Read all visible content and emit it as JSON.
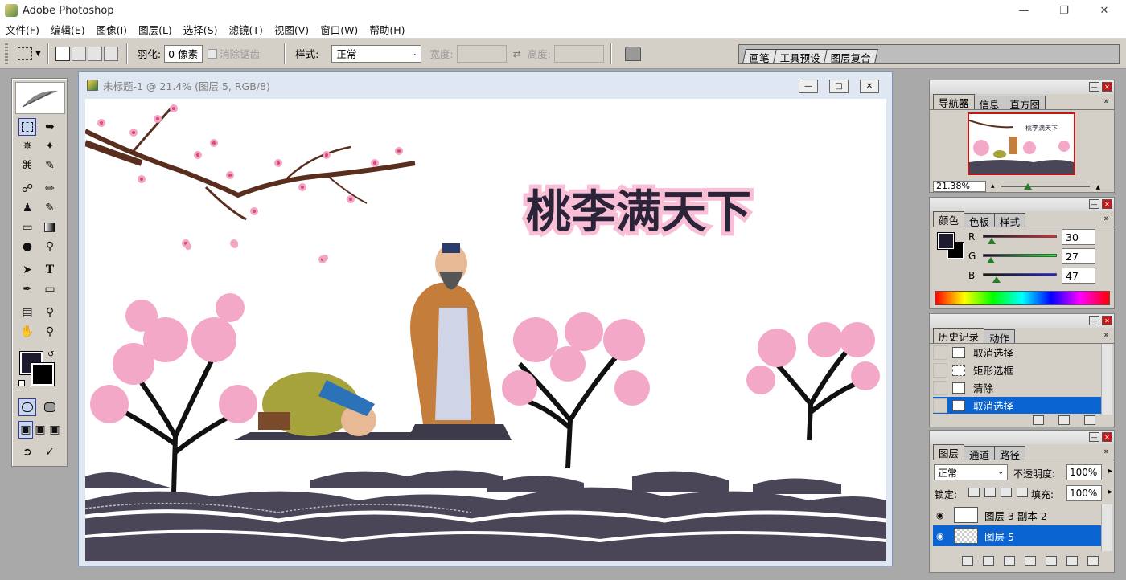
{
  "app": {
    "title": "Adobe Photoshop"
  },
  "menu": [
    "文件(F)",
    "编辑(E)",
    "图像(I)",
    "图层(L)",
    "选择(S)",
    "滤镜(T)",
    "视图(V)",
    "窗口(W)",
    "帮助(H)"
  ],
  "options": {
    "feather_label": "羽化:",
    "feather_value": "0 像素",
    "antialias_label": "消除锯齿",
    "style_label": "样式:",
    "style_value": "正常",
    "width_label": "宽度:",
    "height_label": "高度:"
  },
  "well_tabs": [
    "画笔",
    "工具预设",
    "图层复合"
  ],
  "document": {
    "title": "未标题-1 @ 21.4% (图层 5, RGB/8)",
    "canvas_text": "桃李满天下"
  },
  "navigator": {
    "tabs": [
      "导航器",
      "信息",
      "直方图"
    ],
    "zoom": "21.38%",
    "thumb_text": "桃李满天下"
  },
  "color": {
    "tabs": [
      "颜色",
      "色板",
      "样式"
    ],
    "r_label": "R",
    "g_label": "G",
    "b_label": "B",
    "r": "30",
    "g": "27",
    "b": "47",
    "r_fraction": 0.118,
    "g_fraction": 0.106,
    "b_fraction": 0.184,
    "foreground": "#1e1b2f",
    "background": "#000000"
  },
  "history": {
    "tabs": [
      "历史记录",
      "动作"
    ],
    "items": [
      "取消选择",
      "矩形选框",
      "清除",
      "取消选择"
    ]
  },
  "layers": {
    "tabs": [
      "图层",
      "通道",
      "路径"
    ],
    "blend_mode": "正常",
    "opacity_label": "不透明度:",
    "opacity": "100%",
    "lock_label": "锁定:",
    "fill_label": "填充:",
    "fill": "100%",
    "items": [
      "图层 3 副本 2",
      "图层 5"
    ]
  }
}
